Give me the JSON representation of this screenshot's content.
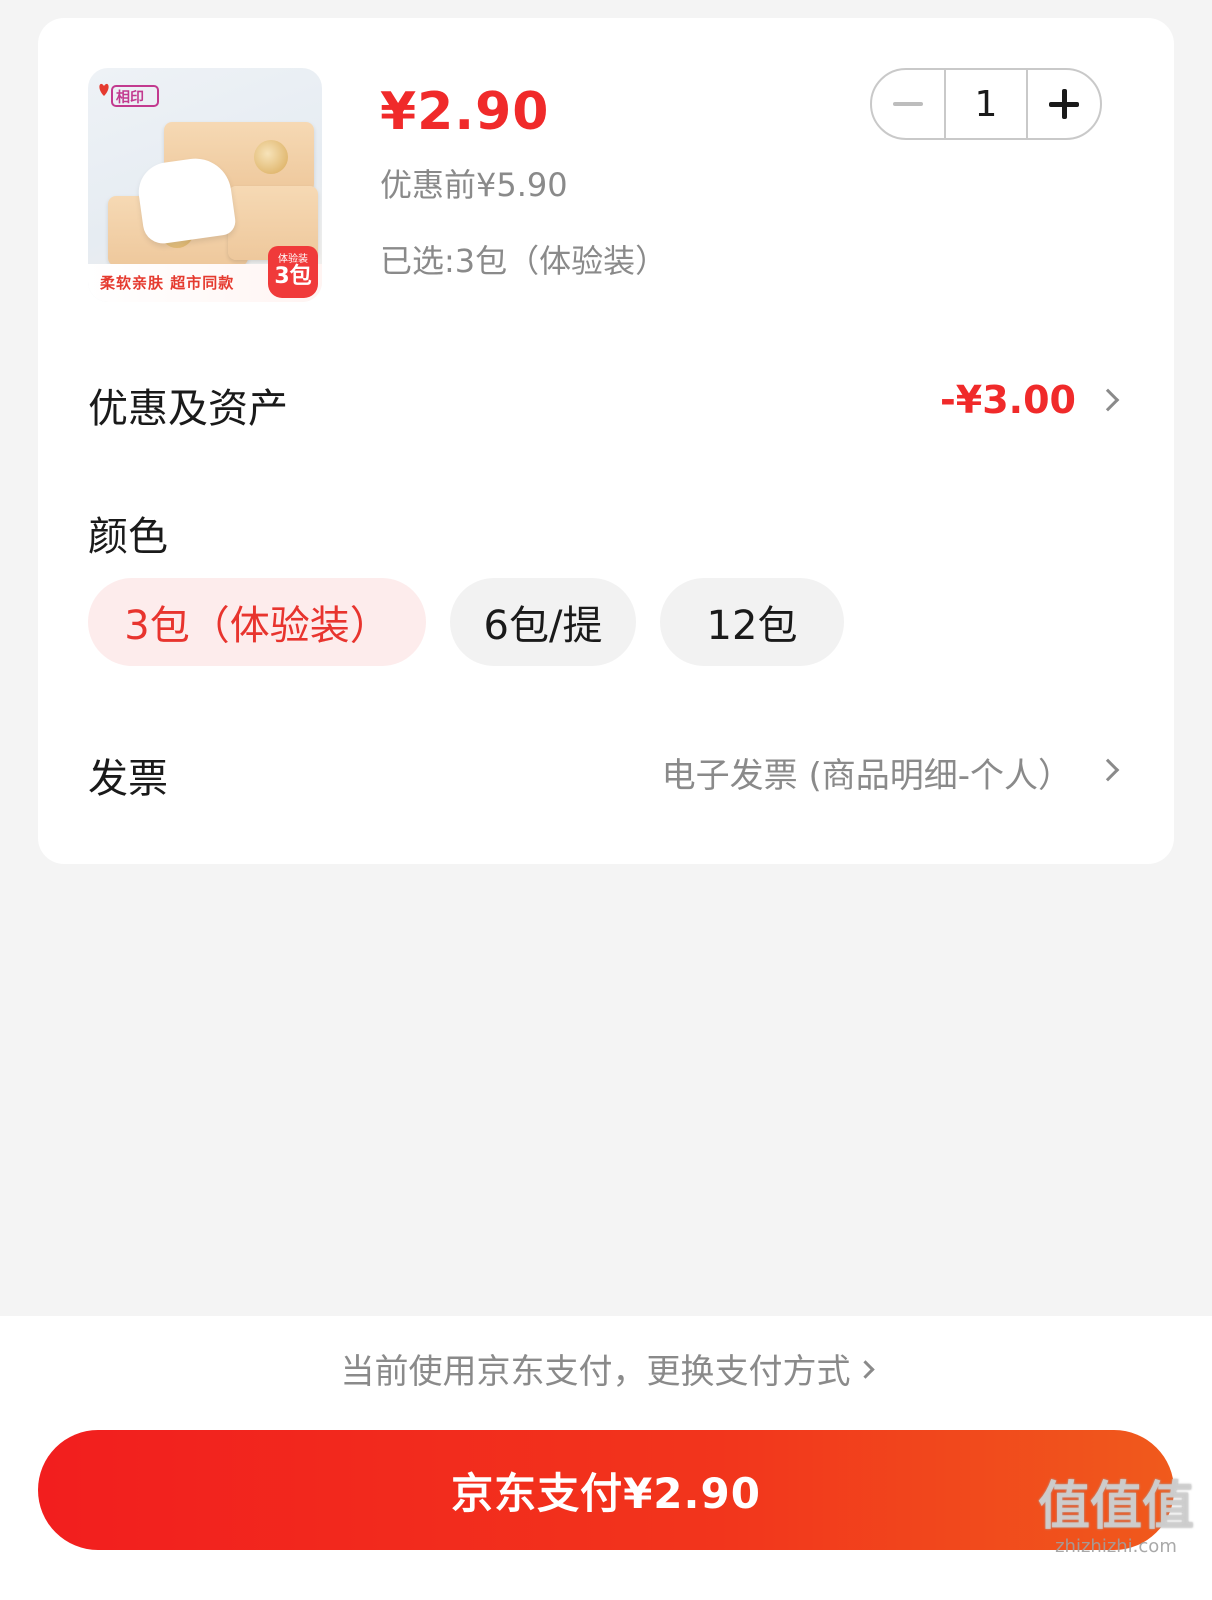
{
  "product": {
    "image_banner_text": "柔软亲肤 超市同款",
    "image_badge_top": "体验装",
    "image_badge_num": "3包",
    "price": "¥2.90",
    "original_price": "优惠前¥5.90",
    "selected": "已选:3包（体验装）"
  },
  "quantity": {
    "value": "1"
  },
  "discount": {
    "label": "优惠及资产",
    "value": "-¥3.00"
  },
  "color": {
    "label": "颜色",
    "options": [
      "3包（体验装）",
      "6包/提",
      "12包"
    ],
    "selected_index": 0
  },
  "invoice": {
    "label": "发票",
    "value": "电子发票 (商品明细-个人）"
  },
  "payment": {
    "switch_text": "当前使用京东支付，更换支付方式",
    "button_label": "京东支付¥2.90"
  },
  "watermark": {
    "big": "值值值",
    "small": "zhizhizhi.com"
  },
  "colors": {
    "accent_red": "#f02a2a",
    "chip_active_bg": "#fdecec"
  }
}
